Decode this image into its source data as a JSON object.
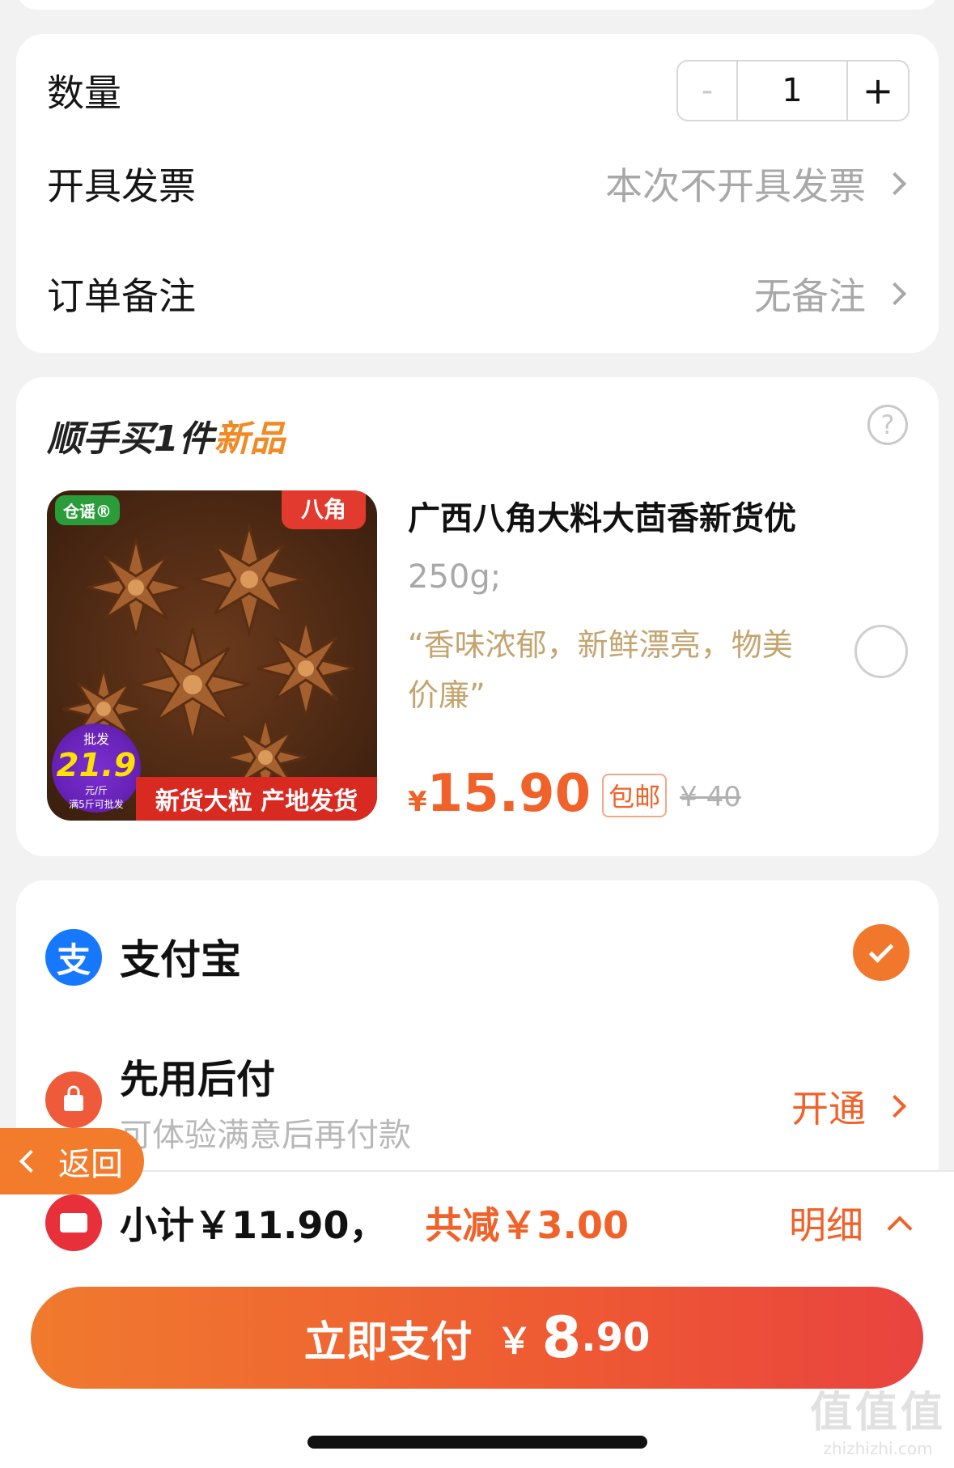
{
  "order": {
    "quantity_label": "数量",
    "quantity_minus": "-",
    "quantity_value": "1",
    "quantity_plus": "+",
    "invoice_label": "开具发票",
    "invoice_value": "本次不开具发票",
    "remark_label": "订单备注",
    "remark_value": "无备注"
  },
  "addon": {
    "title_prefix": "顺手买1件",
    "title_highlight": "新品",
    "help_icon": "?",
    "image": {
      "brand": "仓谣®",
      "top_tag": "八角",
      "promo_top": "批发",
      "promo_price": "21.9",
      "promo_unit": "元/斤",
      "promo_note": "满5斤可批发",
      "banner": "新货大粒 产地发货"
    },
    "name": "广西八角大料大茴香新货优",
    "spec": "250g;",
    "quote": "“香味浓郁，新鲜漂亮，物美价廉”",
    "currency": "¥",
    "price": "15.90",
    "free_shipping": "包邮",
    "original_price": "¥ 40"
  },
  "payment": {
    "alipay_icon_glyph": "支",
    "alipay_label": "支付宝",
    "bnpl_title": "先用后付",
    "bnpl_subtitle": "可体验满意后再付款",
    "bnpl_action": "开通"
  },
  "bottom": {
    "subtotal": "小计￥11.90，",
    "discount": "共减￥3.00",
    "detail": "明细",
    "pay_label": "立即支付",
    "pay_currency": "￥",
    "pay_amount_int": "8",
    "pay_amount_dec": ".90"
  },
  "back": {
    "label": "返回"
  },
  "watermark": {
    "big": "值值值",
    "small": "zhizhizhi.com"
  },
  "colors": {
    "accent": "#f0622a",
    "alipay": "#1677ff",
    "coupon": "#e8303b"
  },
  "icons": [
    "chevron-right-icon",
    "help-icon",
    "alipay-icon",
    "bnpl-icon",
    "check-icon",
    "coupon-icon",
    "chevron-up-icon",
    "chevron-left-icon"
  ]
}
